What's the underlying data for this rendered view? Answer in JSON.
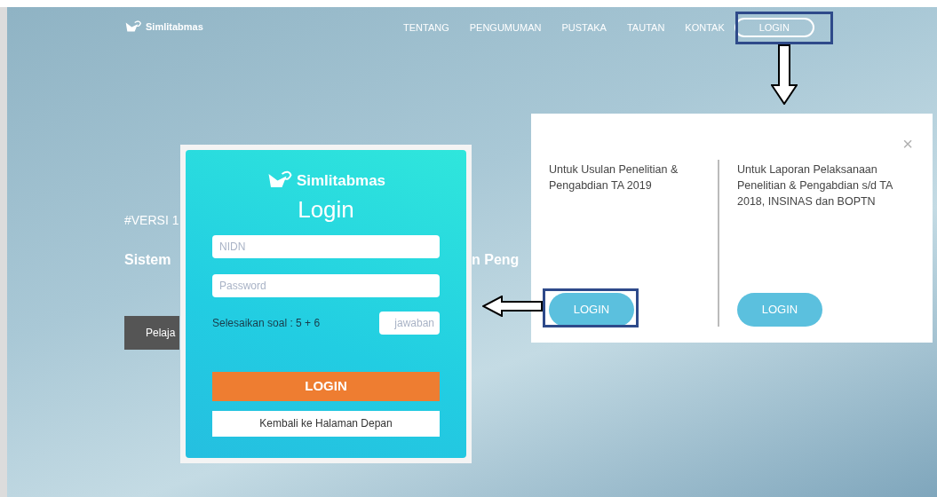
{
  "navbar": {
    "brand": "Simlitabmas",
    "links": [
      "TENTANG",
      "PENGUMUMAN",
      "PUSTAKA",
      "TAUTAN",
      "KONTAK"
    ],
    "login": "LOGIN"
  },
  "hero": {
    "tag": "#VERSI 1",
    "title_left": "Sistem",
    "title_right": "n Peng",
    "button": "Pelaja"
  },
  "login_modal": {
    "close": "×",
    "options": [
      {
        "text": "Untuk Usulan Penelitian & Pengabdian TA 2019",
        "button": "LOGIN"
      },
      {
        "text": "Untuk Laporan Pelaksanaan Penelitian & Pengabdian s/d TA 2018, INSINAS dan BOPTN",
        "button": "LOGIN"
      }
    ]
  },
  "login_form": {
    "brand": "Simlitabmas",
    "title": "Login",
    "fields": [
      {
        "placeholder": "NIDN"
      },
      {
        "placeholder": "Password"
      }
    ],
    "captcha": {
      "question": "Selesaikan soal : 5 + 6",
      "placeholder": "jawaban"
    },
    "submit": "LOGIN",
    "back": "Kembali ke Halaman Depan"
  }
}
